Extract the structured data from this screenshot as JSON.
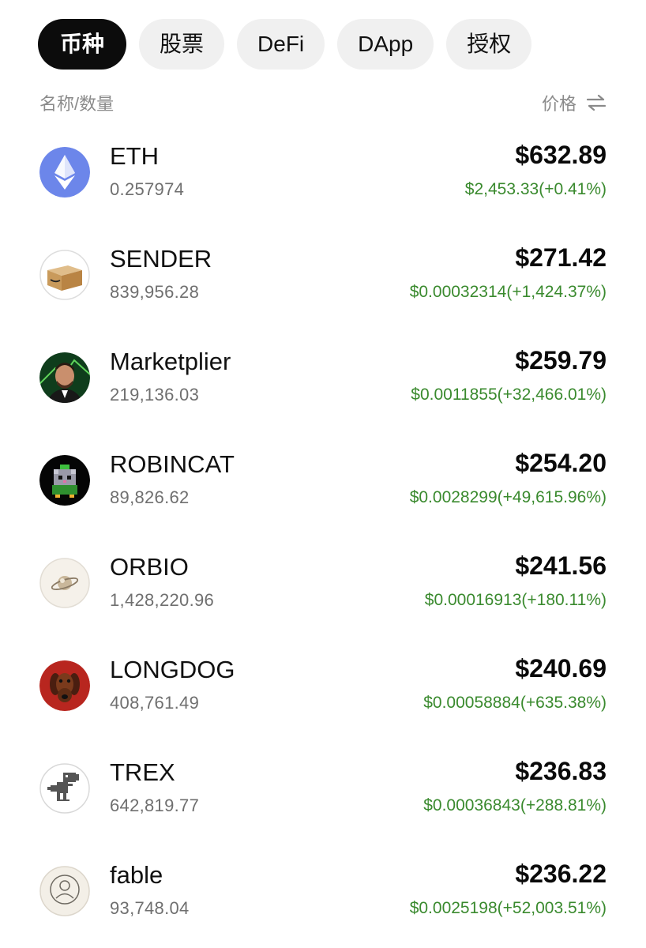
{
  "tabs": [
    {
      "label": "币种",
      "active": true
    },
    {
      "label": "股票",
      "active": false
    },
    {
      "label": "DeFi",
      "active": false
    },
    {
      "label": "DApp",
      "active": false
    },
    {
      "label": "授权",
      "active": false
    }
  ],
  "header": {
    "left_label": "名称/数量",
    "right_label": "价格",
    "sort_icon": "swap-arrows-icon"
  },
  "colors": {
    "positive": "#3a8a2e",
    "active_tab_bg": "#0c0c0c",
    "tab_bg": "#f0f0f0"
  },
  "tokens": [
    {
      "name": "ETH",
      "amount": "0.257974",
      "value": "$632.89",
      "price_change": "$2,453.33(+0.41%)",
      "icon": "ethereum-icon"
    },
    {
      "name": "SENDER",
      "amount": "839,956.28",
      "value": "$271.42",
      "price_change": "$0.00032314(+1,424.37%)",
      "icon": "box-icon"
    },
    {
      "name": "Marketplier",
      "amount": "219,136.03",
      "value": "$259.79",
      "price_change": "$0.0011855(+32,466.01%)",
      "icon": "person-avatar-icon"
    },
    {
      "name": "ROBINCAT",
      "amount": "89,826.62",
      "value": "$254.20",
      "price_change": "$0.0028299(+49,615.96%)",
      "icon": "pixel-cat-icon"
    },
    {
      "name": "ORBIO",
      "amount": "1,428,220.96",
      "value": "$241.56",
      "price_change": "$0.00016913(+180.11%)",
      "icon": "planet-icon"
    },
    {
      "name": "LONGDOG",
      "amount": "408,761.49",
      "value": "$240.69",
      "price_change": "$0.00058884(+635.38%)",
      "icon": "dog-icon"
    },
    {
      "name": "TREX",
      "amount": "642,819.77",
      "value": "$236.83",
      "price_change": "$0.00036843(+288.81%)",
      "icon": "dinosaur-icon"
    },
    {
      "name": "fable",
      "amount": "93,748.04",
      "value": "$236.22",
      "price_change": "$0.0025198(+52,003.51%)",
      "icon": "fable-logo-icon"
    }
  ]
}
